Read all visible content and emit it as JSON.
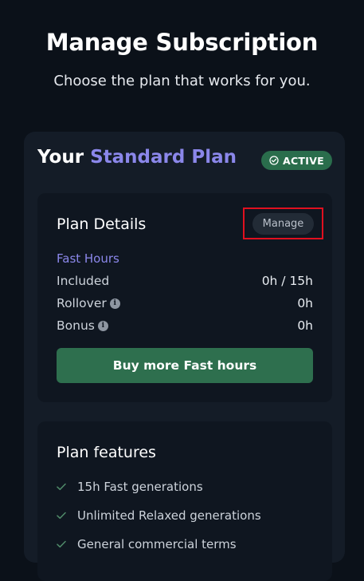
{
  "header": {
    "title": "Manage Subscription",
    "subtitle": "Choose the plan that works for you."
  },
  "plan": {
    "prefix": "Your",
    "name": "Standard Plan",
    "status_badge": "ACTIVE"
  },
  "details": {
    "title": "Plan Details",
    "manage_label": "Manage",
    "section_label": "Fast Hours",
    "rows": [
      {
        "label": "Included",
        "value": "0h / 15h"
      },
      {
        "label": "Rollover",
        "value": "0h"
      },
      {
        "label": "Bonus",
        "value": "0h"
      }
    ],
    "buy_label": "Buy more Fast hours"
  },
  "features": {
    "title": "Plan features",
    "items": [
      "15h Fast generations",
      "Unlimited Relaxed generations",
      "General commercial terms"
    ]
  },
  "colors": {
    "background": "#0b1119",
    "accent_purple": "#8b87ea",
    "active_green": "#2a6d4c",
    "button_green": "#2e6f4e",
    "highlight_red": "#e0101f"
  },
  "icons": {
    "active": "check-circle-icon",
    "info": "info-icon",
    "feature": "check-icon"
  }
}
